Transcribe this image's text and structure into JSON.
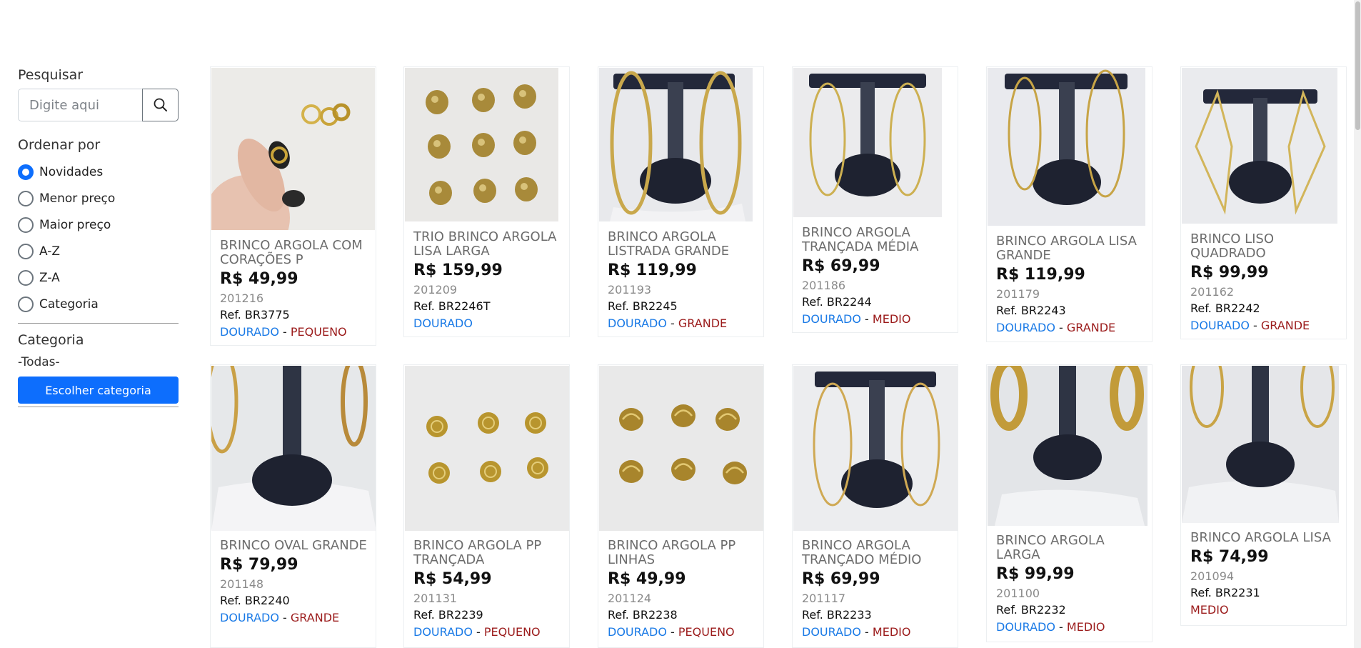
{
  "sidebar": {
    "search_title": "Pesquisar",
    "search_placeholder": "Digite aqui",
    "search_icon": "search-icon",
    "sort_title": "Ordenar por",
    "sort_options": [
      "Novidades",
      "Menor preço",
      "Maior preço",
      "A-Z",
      "Z-A",
      "Categoria"
    ],
    "sort_selected": "Novidades",
    "category_title": "Categoria",
    "category_value": "-Todas-",
    "category_button": "Escolher categoria"
  },
  "colors": {
    "primary": "#0d6efd",
    "tag_color": "#1a7ae6",
    "tag_size": "#9b1b1b"
  },
  "products": [
    {
      "name": "BRINCO ARGOLA COM CORAÇÕES P",
      "price": "R$ 49,99",
      "code": "201216",
      "ref": "Ref. BR3775",
      "color": "DOURADO",
      "sep": " - ",
      "size": "PEQUENO"
    },
    {
      "name": "TRIO BRINCO ARGOLA LISA LARGA",
      "price": "R$ 159,99",
      "code": "201209",
      "ref": "Ref. BR2246T",
      "color": "DOURADO",
      "sep": "",
      "size": ""
    },
    {
      "name": "BRINCO ARGOLA LISTRADA GRANDE",
      "price": "R$ 119,99",
      "code": "201193",
      "ref": "Ref. BR2245",
      "color": "DOURADO",
      "sep": " - ",
      "size": "GRANDE"
    },
    {
      "name": "BRINCO ARGOLA TRANÇADA MÉDIA",
      "price": "R$ 69,99",
      "code": "201186",
      "ref": "Ref. BR2244",
      "color": "DOURADO",
      "sep": " - ",
      "size": "MEDIO"
    },
    {
      "name": "BRINCO ARGOLA LISA GRANDE",
      "price": "R$ 119,99",
      "code": "201179",
      "ref": "Ref. BR2243",
      "color": "DOURADO",
      "sep": " - ",
      "size": "GRANDE"
    },
    {
      "name": "BRINCO LISO QUADRADO",
      "price": "R$ 99,99",
      "code": "201162",
      "ref": "Ref. BR2242",
      "color": "DOURADO",
      "sep": " - ",
      "size": "GRANDE"
    },
    {
      "name": "BRINCO OVAL GRANDE",
      "price": "R$ 79,99",
      "code": "201148",
      "ref": "Ref. BR2240",
      "color": "DOURADO",
      "sep": " - ",
      "size": "GRANDE"
    },
    {
      "name": "BRINCO ARGOLA PP TRANÇADA",
      "price": "R$ 54,99",
      "code": "201131",
      "ref": "Ref. BR2239",
      "color": "DOURADO",
      "sep": " - ",
      "size": "PEQUENO"
    },
    {
      "name": "BRINCO ARGOLA PP LINHAS",
      "price": "R$ 49,99",
      "code": "201124",
      "ref": "Ref. BR2238",
      "color": "DOURADO",
      "sep": " - ",
      "size": "PEQUENO"
    },
    {
      "name": "BRINCO ARGOLA TRANÇADO MÉDIO",
      "price": "R$ 69,99",
      "code": "201117",
      "ref": "Ref. BR2233",
      "color": "DOURADO",
      "sep": " - ",
      "size": "MEDIO"
    },
    {
      "name": "BRINCO ARGOLA LARGA",
      "price": "R$ 99,99",
      "code": "201100",
      "ref": "Ref. BR2232",
      "color": "DOURADO",
      "sep": " - ",
      "size": "MEDIO"
    },
    {
      "name": "BRINCO ARGOLA LISA",
      "price": "R$ 74,99",
      "code": "201094",
      "ref": "Ref. BR2231",
      "color": "",
      "sep": "",
      "size": "MEDIO"
    }
  ]
}
